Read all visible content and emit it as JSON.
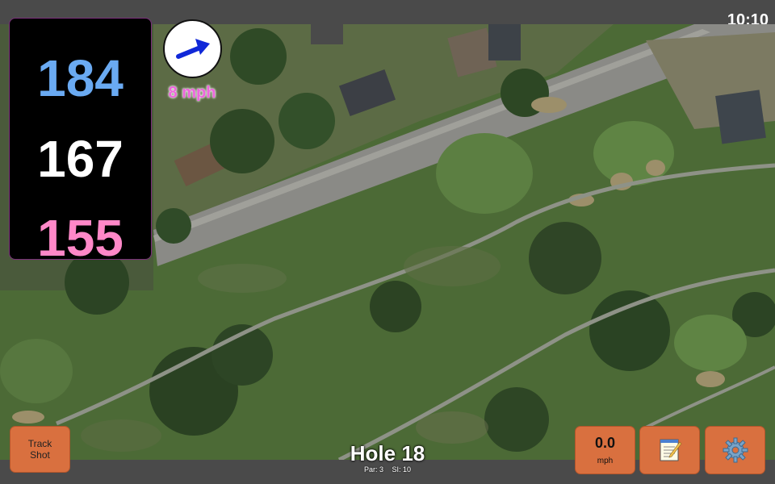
{
  "status": {
    "time": "10:10"
  },
  "distances": {
    "back": "184",
    "middle": "167",
    "front": "155"
  },
  "wind": {
    "speed_label": "8 mph",
    "direction_icon": "arrow-up-right-icon"
  },
  "hole": {
    "title": "Hole 18",
    "par": "Par: 3",
    "si": "SI: 10"
  },
  "buttons": {
    "track_line1": "Track",
    "track_line2": "Shot",
    "speed_value": "0.0",
    "speed_unit": "mph",
    "notes_icon": "notepad-icon",
    "settings_icon": "gear-icon"
  },
  "colors": {
    "back": "#6aaaf2",
    "middle": "#ffffff",
    "front": "#ff88c8",
    "button": "#d9703f",
    "wind_text": "#ee66dd"
  }
}
